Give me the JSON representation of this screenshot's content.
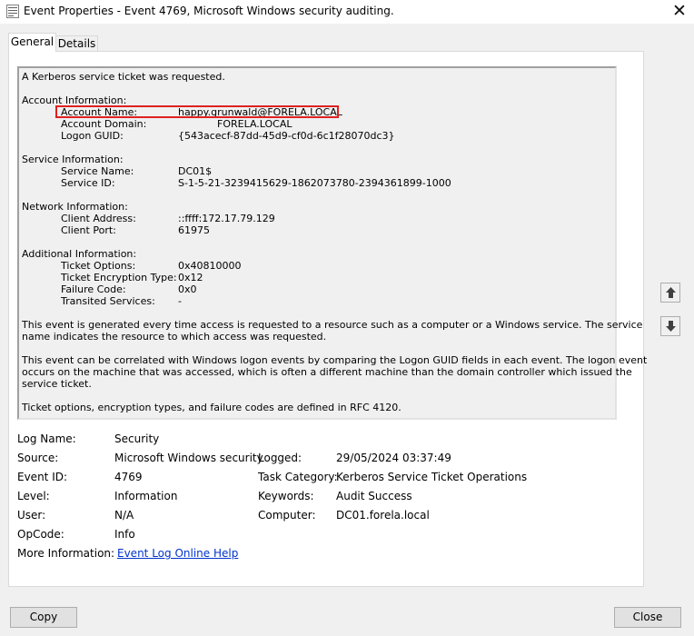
{
  "window": {
    "title": "Event Properties - Event 4769, Microsoft Windows security auditing.",
    "close_glyph": "✕"
  },
  "tabs": [
    {
      "label": "General",
      "selected": true
    },
    {
      "label": "Details",
      "selected": false
    }
  ],
  "description": {
    "intro": "A Kerberos service ticket was requested.",
    "account_header": "Account Information:",
    "account": {
      "name_label": "Account Name:",
      "name_value": "happy.grunwald@FORELA.LOCAL",
      "domain_label": "Account Domain:",
      "domain_value": "FORELA.LOCAL",
      "guid_label": "Logon GUID:",
      "guid_value": "{543acecf-87dd-45d9-cf0d-6c1f28070dc3}"
    },
    "service_header": "Service Information:",
    "service": {
      "name_label": "Service Name:",
      "name_value": "DC01$",
      "id_label": "Service ID:",
      "id_value": "S-1-5-21-3239415629-1862073780-2394361899-1000"
    },
    "network_header": "Network Information:",
    "network": {
      "address_label": "Client Address:",
      "address_value": "::ffff:172.17.79.129",
      "port_label": "Client Port:",
      "port_value": "61975"
    },
    "additional_header": "Additional Information:",
    "additional": {
      "options_label": "Ticket Options:",
      "options_value": "0x40810000",
      "enc_label": "Ticket Encryption Type:",
      "enc_value": "0x12",
      "failure_label": "Failure Code:",
      "failure_value": "0x0",
      "transited_label": "Transited Services:",
      "transited_value": "-"
    },
    "para1_line1": "This event is generated every time access is requested to a resource such as a computer or a Windows service.  The service",
    "para1_line2": "name indicates the resource to which access was requested.",
    "para2_line1": "This event can be correlated with Windows logon events by comparing the Logon GUID fields in each event.  The logon event",
    "para2_line2": "occurs on the machine that was accessed, which is often a different machine than the domain controller which issued the",
    "para2_line3": "service ticket.",
    "para3": "Ticket options, encryption types, and failure codes are defined in RFC 4120."
  },
  "fields": {
    "log_name_label": "Log Name:",
    "log_name_value": "Security",
    "source_label": "Source:",
    "source_value": "Microsoft Windows security",
    "logged_label": "Logged:",
    "logged_value": "29/05/2024 03:37:49",
    "event_id_label": "Event ID:",
    "event_id_value": "4769",
    "task_category_label": "Task Category:",
    "task_category_value": "Kerberos Service Ticket Operations",
    "level_label": "Level:",
    "level_value": "Information",
    "keywords_label": "Keywords:",
    "keywords_value": "Audit Success",
    "user_label": "User:",
    "user_value": "N/A",
    "computer_label": "Computer:",
    "computer_value": "DC01.forela.local",
    "opcode_label": "OpCode:",
    "opcode_value": "Info",
    "more_info_label": "More Information:",
    "more_info_link": "Event Log Online Help"
  },
  "buttons": {
    "copy": "Copy",
    "close": "Close"
  },
  "icons": {
    "app": "event-viewer-icon",
    "up": "arrow-up-icon",
    "down": "arrow-down-icon"
  },
  "colors": {
    "highlight": "#e02020",
    "link": "#0033cc"
  }
}
